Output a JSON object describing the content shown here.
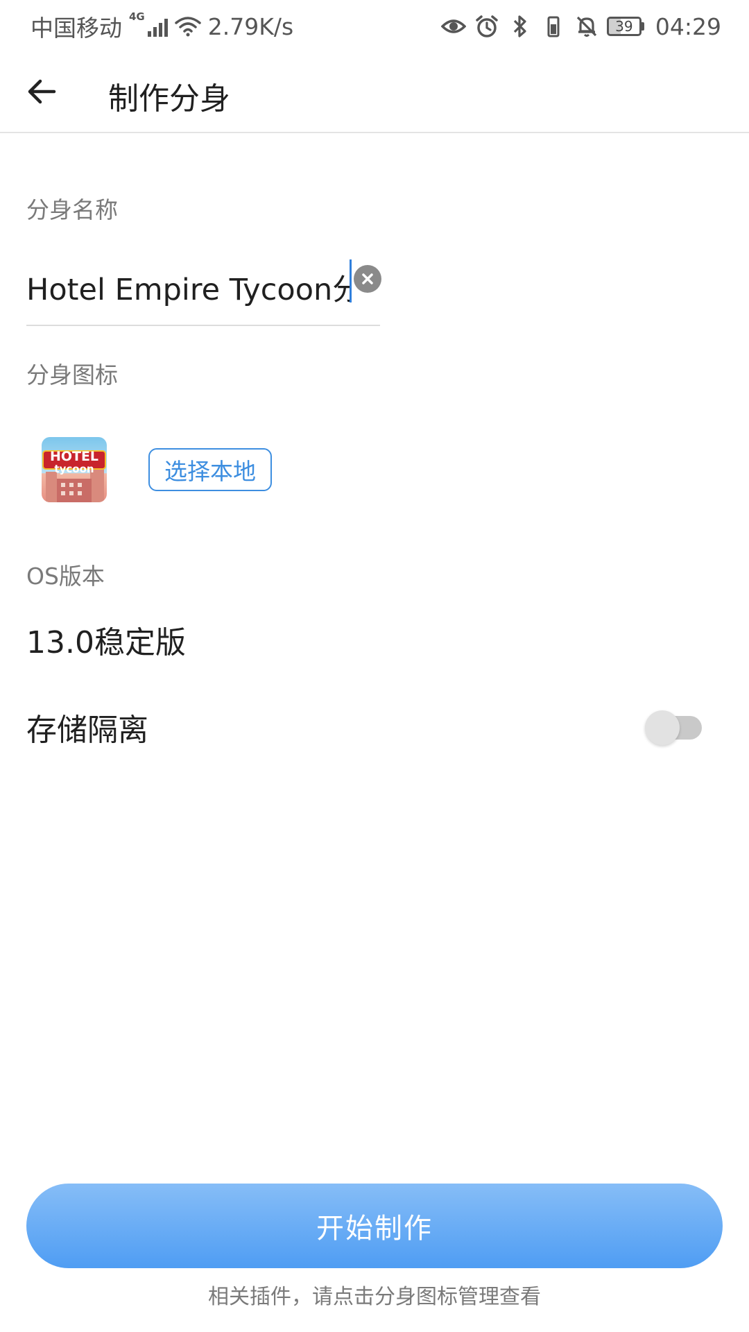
{
  "status_bar": {
    "carrier": "中国移动",
    "network_type": "4G",
    "speed": "2.79K/s",
    "battery": "39",
    "time": "04:29"
  },
  "app_bar": {
    "title": "制作分身"
  },
  "form": {
    "name_label": "分身名称",
    "name_value": "Hotel Empire Tycoon分身",
    "icon_label": "分身图标",
    "icon_text_top": "HOTEL",
    "icon_text_bottom": "tycoon",
    "choose_local_label": "选择本地",
    "os_label": "OS版本",
    "os_value": "13.0稳定版",
    "storage_isolation_label": "存储隔离",
    "storage_isolation_enabled": false
  },
  "footer": {
    "start_button_label": "开始制作",
    "hint": "相关插件，请点击分身图标管理查看"
  },
  "colors": {
    "accent": "#3d8ee0",
    "button_top": "#86bdf7",
    "button_bottom": "#4f9df3"
  }
}
